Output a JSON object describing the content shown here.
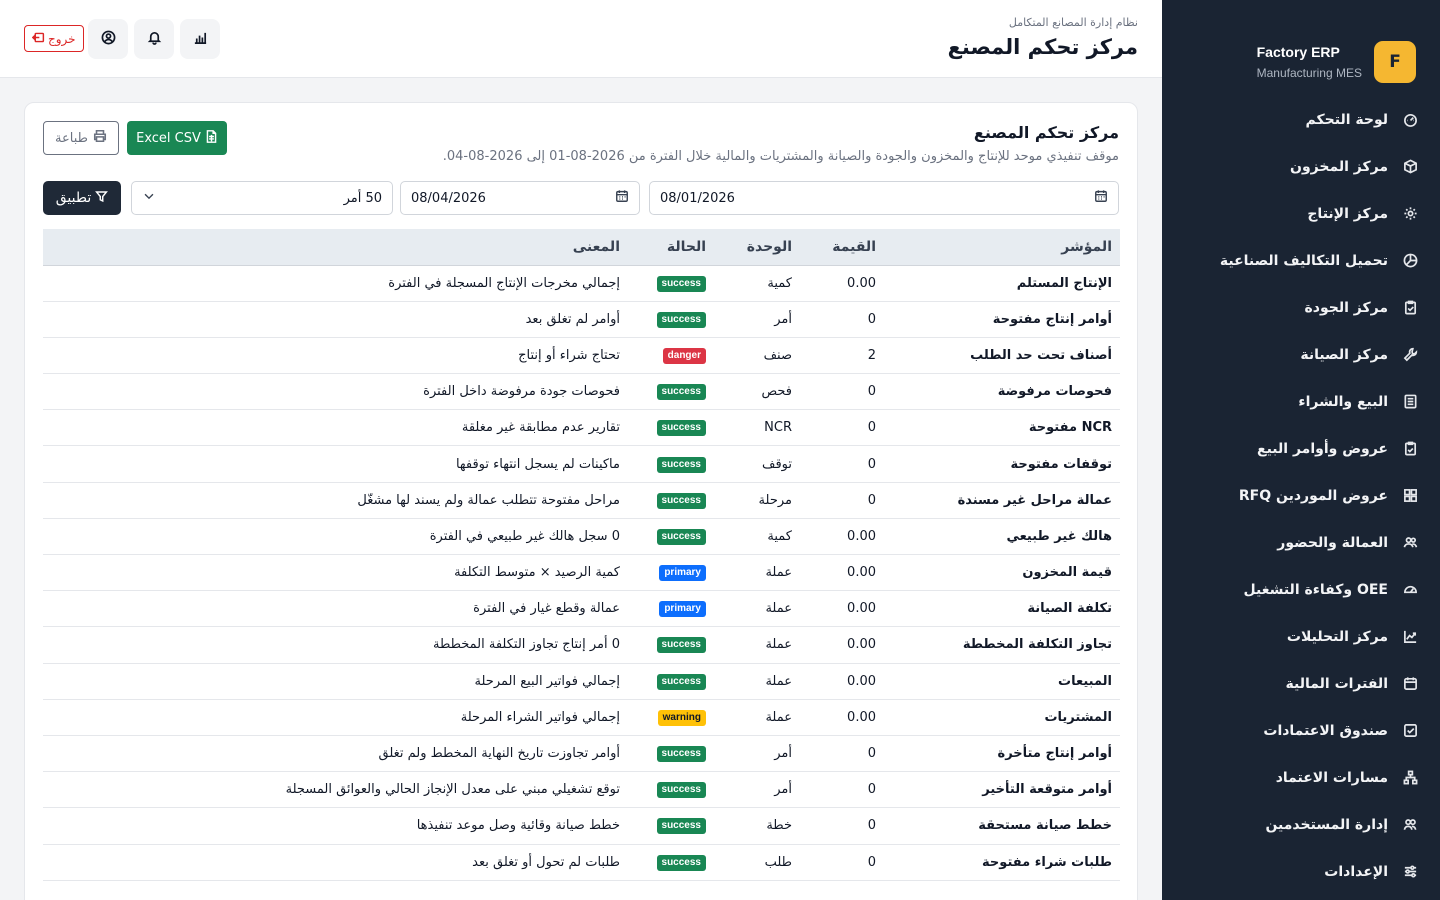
{
  "brand": {
    "logo_letter": "F",
    "name": "Factory ERP",
    "subtitle": "Manufacturing MES",
    "accent": "#f5b731"
  },
  "sidebar": {
    "items": [
      {
        "label": "لوحة التحكم",
        "icon": "dashboard-icon"
      },
      {
        "label": "مركز المخزون",
        "icon": "box-icon"
      },
      {
        "label": "مركز الإنتاج",
        "icon": "gear-icon"
      },
      {
        "label": "تحميل التكاليف الصناعية",
        "icon": "pie-chart-icon"
      },
      {
        "label": "مركز الجودة",
        "icon": "clipboard-check-icon"
      },
      {
        "label": "مركز الصيانة",
        "icon": "wrench-icon"
      },
      {
        "label": "البيع والشراء",
        "icon": "ledger-icon"
      },
      {
        "label": "عروض وأوامر البيع",
        "icon": "clipboard-icon"
      },
      {
        "label": "عروض الموردين RFQ",
        "icon": "grid-icon"
      },
      {
        "label": "العمالة والحضور",
        "icon": "users-icon"
      },
      {
        "label": "OEE وكفاءة التشغيل",
        "icon": "speedometer-icon"
      },
      {
        "label": "مركز التحليلات",
        "icon": "graph-up-icon"
      },
      {
        "label": "الفترات المالية",
        "icon": "calendar-icon"
      },
      {
        "label": "صندوق الاعتمادات",
        "icon": "check-square-icon"
      },
      {
        "label": "مسارات الاعتماد",
        "icon": "diagram-icon"
      },
      {
        "label": "إدارة المستخدمين",
        "icon": "people-icon"
      },
      {
        "label": "الإعدادات",
        "icon": "sliders-icon"
      }
    ]
  },
  "header": {
    "subtitle": "نظام إدارة المصانع المتكامل",
    "title": "مركز تحكم المصنع",
    "logout_label": "خروج"
  },
  "card": {
    "title": "مركز تحكم المصنع",
    "description": "موقف تنفيذي موحد للإنتاج والمخزون والجودة والصيانة والمشتريات والمالية خلال الفترة من 2026-08-01 إلى 2026-08-04.",
    "excel_label": "Excel CSV",
    "print_label": "طباعة"
  },
  "filters": {
    "date_from": "08/01/2026",
    "date_to": "08/04/2026",
    "limit_selected": "50 أمر",
    "apply_label": "تطبيق"
  },
  "table": {
    "headers": {
      "indicator": "المؤشر",
      "value": "القيمة",
      "unit": "الوحدة",
      "status": "الحالة",
      "meaning": "المعنى"
    },
    "rows": [
      {
        "indicator": "الإنتاج المستلم",
        "value": "0.00",
        "unit": "كمية",
        "status": "success",
        "meaning": "إجمالي مخرجات الإنتاج المسجلة في الفترة"
      },
      {
        "indicator": "أوامر إنتاج مفتوحة",
        "value": "0",
        "unit": "أمر",
        "status": "success",
        "meaning": "أوامر لم تغلق بعد"
      },
      {
        "indicator": "أصناف تحت حد الطلب",
        "value": "2",
        "unit": "صنف",
        "status": "danger",
        "meaning": "تحتاج شراء أو إنتاج"
      },
      {
        "indicator": "فحوصات مرفوضة",
        "value": "0",
        "unit": "فحص",
        "status": "success",
        "meaning": "فحوصات جودة مرفوضة داخل الفترة"
      },
      {
        "indicator": "NCR مفتوحة",
        "value": "0",
        "unit": "NCR",
        "status": "success",
        "meaning": "تقارير عدم مطابقة غير مغلقة"
      },
      {
        "indicator": "توقفات مفتوحة",
        "value": "0",
        "unit": "توقف",
        "status": "success",
        "meaning": "ماكينات لم يسجل انتهاء توقفها"
      },
      {
        "indicator": "عمالة مراحل غير مسندة",
        "value": "0",
        "unit": "مرحلة",
        "status": "success",
        "meaning": "مراحل مفتوحة تتطلب عمالة ولم يسند لها مشغّل"
      },
      {
        "indicator": "هالك غير طبيعي",
        "value": "0.00",
        "unit": "كمية",
        "status": "success",
        "meaning": "0 سجل هالك غير طبيعي في الفترة"
      },
      {
        "indicator": "قيمة المخزون",
        "value": "0.00",
        "unit": "عملة",
        "status": "primary",
        "meaning": "كمية الرصيد × متوسط التكلفة"
      },
      {
        "indicator": "تكلفة الصيانة",
        "value": "0.00",
        "unit": "عملة",
        "status": "primary",
        "meaning": "عمالة وقطع غيار في الفترة"
      },
      {
        "indicator": "تجاوز التكلفة المخططة",
        "value": "0.00",
        "unit": "عملة",
        "status": "success",
        "meaning": "0 أمر إنتاج تجاوز التكلفة المخططة"
      },
      {
        "indicator": "المبيعات",
        "value": "0.00",
        "unit": "عملة",
        "status": "success",
        "meaning": "إجمالي فواتير البيع المرحلة"
      },
      {
        "indicator": "المشتريات",
        "value": "0.00",
        "unit": "عملة",
        "status": "warning",
        "meaning": "إجمالي فواتير الشراء المرحلة"
      },
      {
        "indicator": "أوامر إنتاج متأخرة",
        "value": "0",
        "unit": "أمر",
        "status": "success",
        "meaning": "أوامر تجاوزت تاريخ النهاية المخطط ولم تغلق"
      },
      {
        "indicator": "أوامر متوقعة التأخير",
        "value": "0",
        "unit": "أمر",
        "status": "success",
        "meaning": "توقع تشغيلي مبني على معدل الإنجاز الحالي والعوائق المسجلة"
      },
      {
        "indicator": "خطط صيانة مستحقة",
        "value": "0",
        "unit": "خطة",
        "status": "success",
        "meaning": "خطط صيانة وقائية وصل موعد تنفيذها"
      },
      {
        "indicator": "طلبات شراء مفتوحة",
        "value": "0",
        "unit": "طلب",
        "status": "success",
        "meaning": "طلبات لم تحول أو تغلق بعد"
      }
    ]
  },
  "colors": {
    "sidebar_bg": "#1a2433",
    "success": "#198754",
    "danger": "#dc3545",
    "primary": "#0d6efd",
    "warning": "#ffc107"
  }
}
